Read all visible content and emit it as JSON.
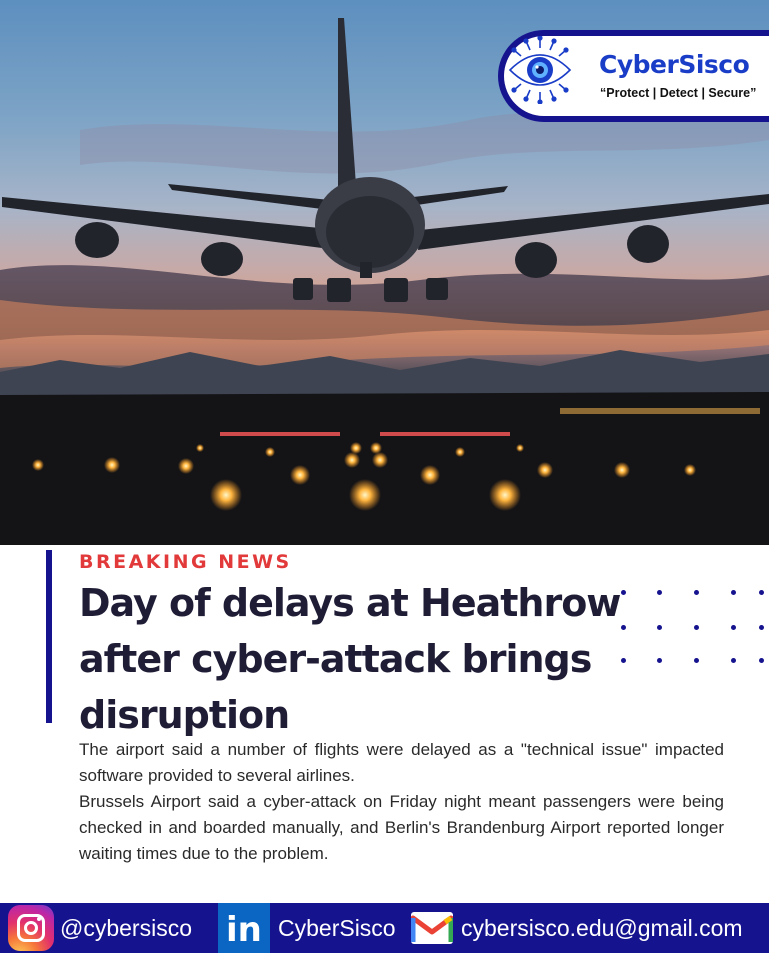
{
  "brand": {
    "name": "CyberSisco",
    "tagline": "“Protect | Detect | Secure”"
  },
  "article": {
    "kicker": "BREAKING NEWS",
    "headline": "Day of delays at Heathrow after cyber-attack brings disruption",
    "paragraphs": [
      "The airport said a number of flights were delayed as a \"technical issue\" impacted software provided to several airlines.",
      "Brussels Airport said a cyber-attack on Friday night meant passengers were being checked in and boarded manually, and Berlin's Brandenburg Airport reported longer waiting times due to the problem."
    ]
  },
  "footer": {
    "instagram": "@cybersisco",
    "linkedin": "CyberSisco",
    "email": "cybersisco.edu@gmail.com"
  },
  "colors": {
    "navy": "#16138f",
    "kicker_red": "#e23a3a",
    "headline": "#1f1d36"
  },
  "icons": {
    "logo": "eye-circuit-icon",
    "instagram": "instagram-icon",
    "linkedin": "linkedin-icon",
    "gmail": "gmail-icon"
  }
}
